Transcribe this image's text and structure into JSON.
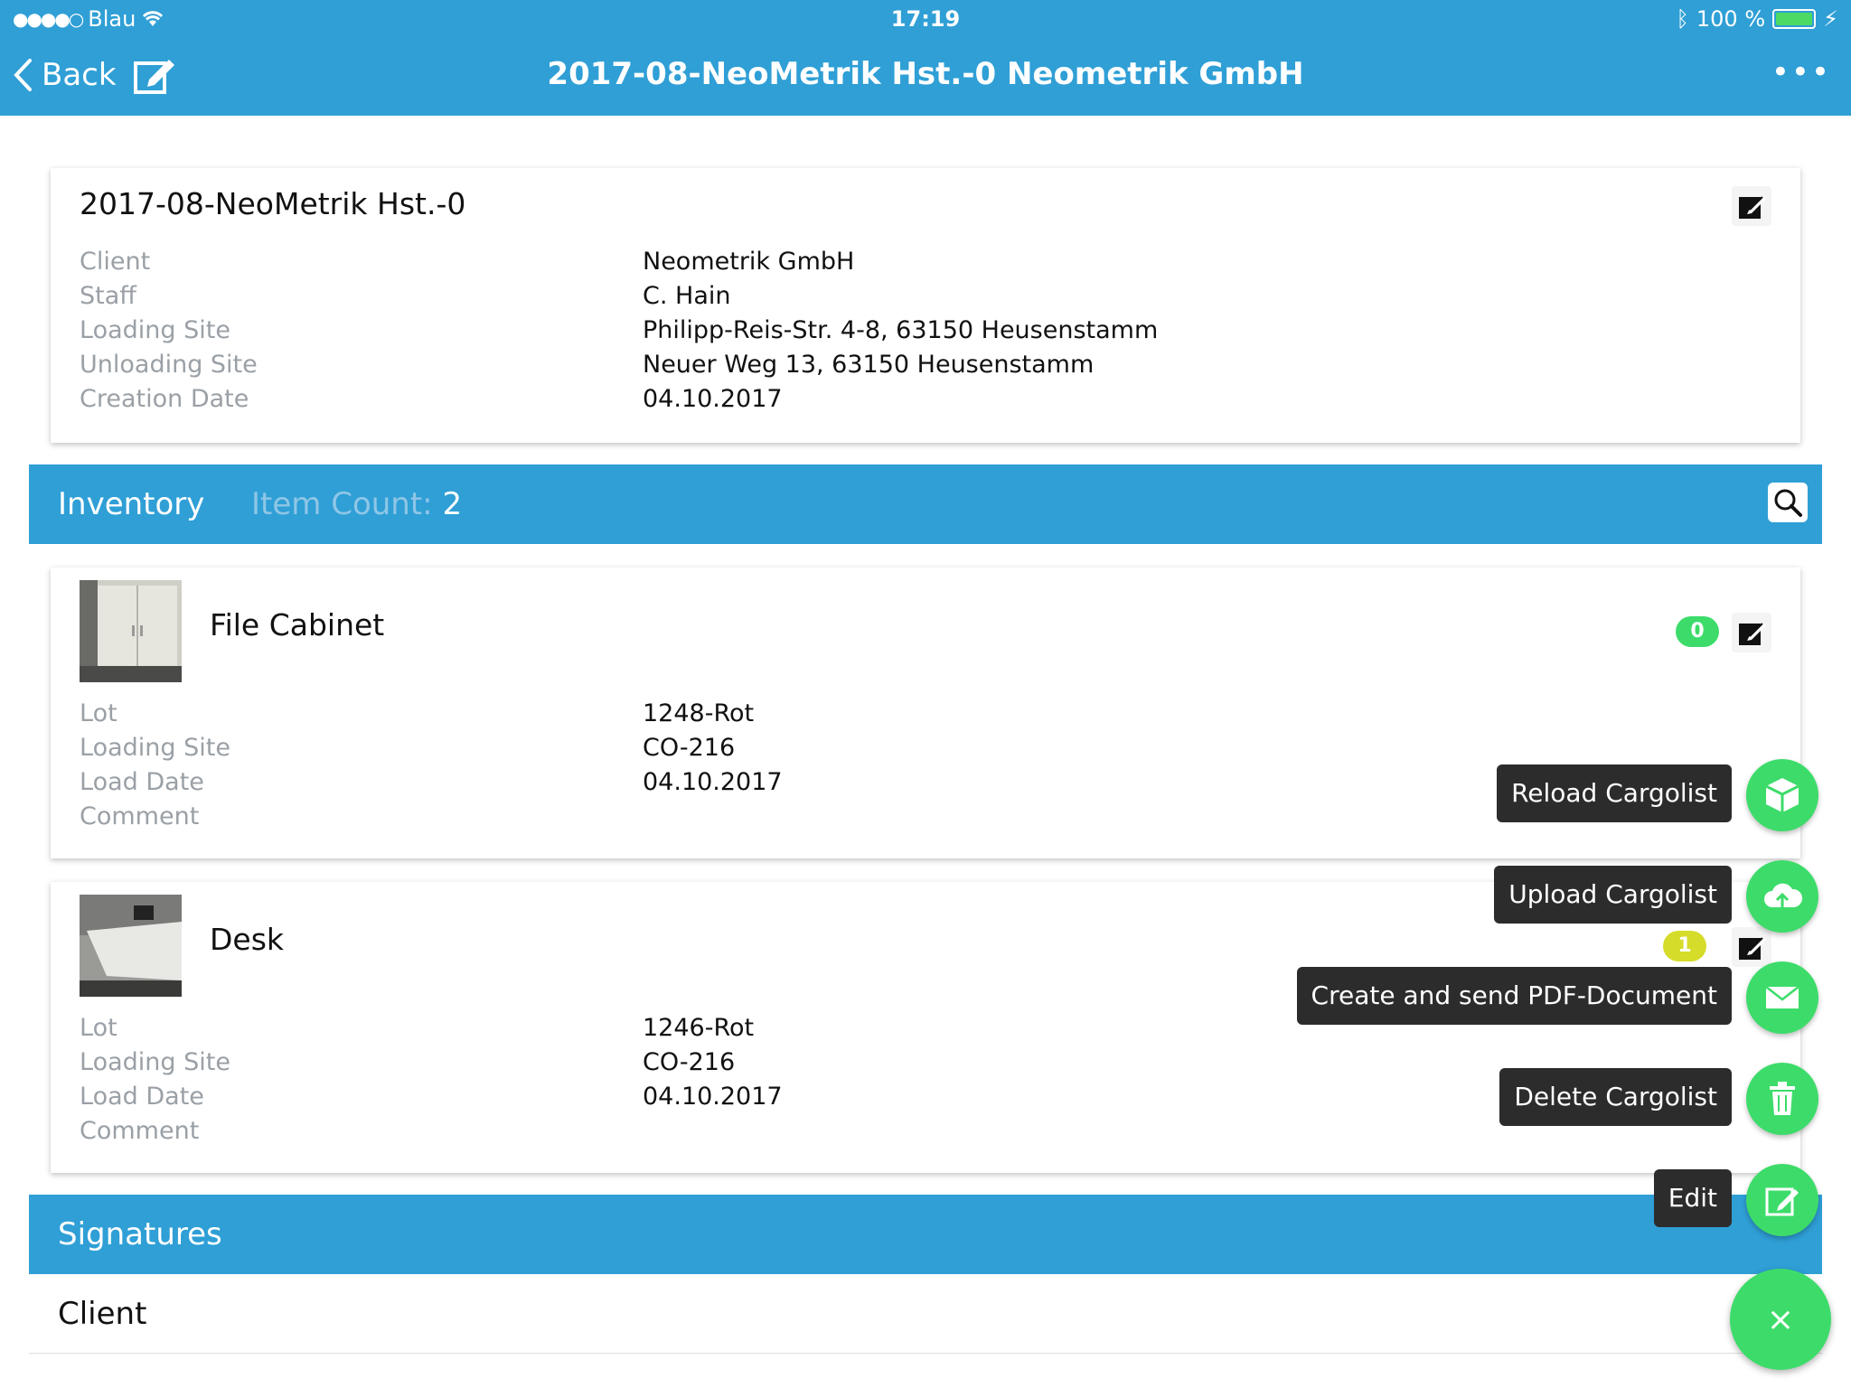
{
  "status": {
    "carrier": "Blau",
    "time": "17:19",
    "battery": "100 %"
  },
  "nav": {
    "back_label": "Back",
    "title": "2017-08-NeoMetrik Hst.-0 Neometrik GmbH"
  },
  "header_card": {
    "title": "2017-08-NeoMetrik Hst.-0",
    "rows": [
      {
        "label": "Client",
        "value": "Neometrik GmbH"
      },
      {
        "label": "Staff",
        "value": "C. Hain"
      },
      {
        "label": "Loading Site",
        "value": "Philipp-Reis-Str. 4-8, 63150 Heusenstamm"
      },
      {
        "label": "Unloading Site",
        "value": "Neuer Weg 13, 63150 Heusenstamm"
      },
      {
        "label": "Creation Date",
        "value": "04.10.2017"
      }
    ]
  },
  "inventory": {
    "title": "Inventory",
    "count_label": "Item Count:",
    "count": "2"
  },
  "items": [
    {
      "name": "File Cabinet",
      "badge": "0",
      "badge_color": "#3ddc6a",
      "rows": [
        {
          "label": "Lot",
          "value": "1248-Rot"
        },
        {
          "label": "Loading Site",
          "value": "CO-216"
        },
        {
          "label": "Load Date",
          "value": "04.10.2017"
        },
        {
          "label": "Comment",
          "value": ""
        }
      ]
    },
    {
      "name": "Desk",
      "badge": "1",
      "badge_color": "#d6dc2a",
      "rows": [
        {
          "label": "Lot",
          "value": "1246-Rot"
        },
        {
          "label": "Loading Site",
          "value": "CO-216"
        },
        {
          "label": "Load Date",
          "value": "04.10.2017"
        },
        {
          "label": "Comment",
          "value": ""
        }
      ]
    }
  ],
  "signatures": {
    "title": "Signatures",
    "client_label": "Client"
  },
  "fab_menu": {
    "reload": "Reload Cargolist",
    "upload": "Upload Cargolist",
    "pdf": "Create and send PDF-Document",
    "delete": "Delete Cargolist",
    "edit": "Edit",
    "close": "×"
  },
  "colors": {
    "accent": "#2f9fd6",
    "fab": "#3ddc6a"
  }
}
